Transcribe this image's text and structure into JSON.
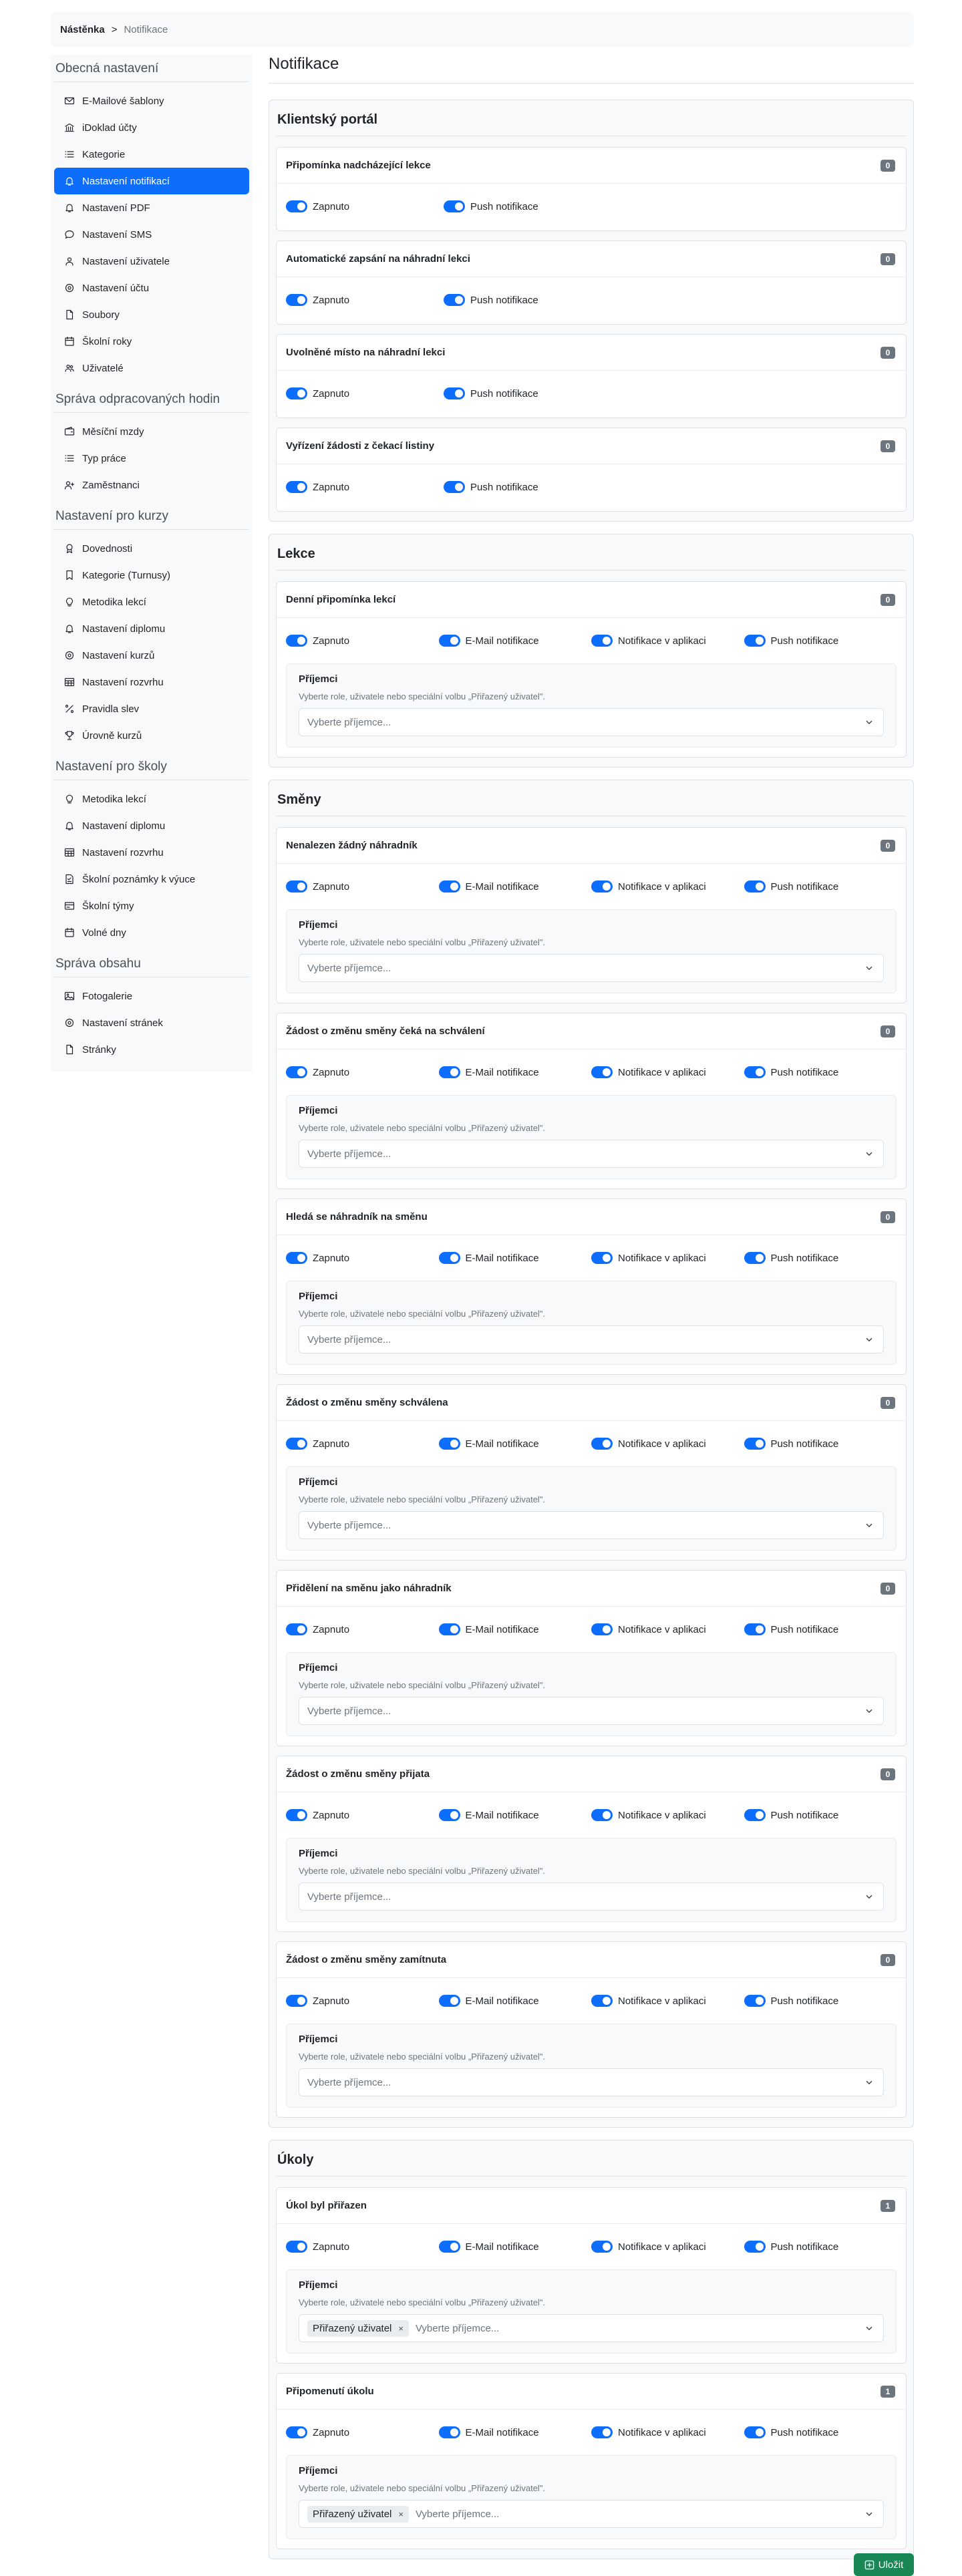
{
  "breadcrumb": {
    "home": "Nástěnka",
    "separator": ">",
    "current": "Notifikace"
  },
  "sidebar": {
    "sections": [
      {
        "title": "Obecná nastavení",
        "items": [
          {
            "label": "E-Mailové šablony",
            "icon": "mail-icon"
          },
          {
            "label": "iDoklad účty",
            "icon": "bank-icon"
          },
          {
            "label": "Kategorie",
            "icon": "list-icon"
          },
          {
            "label": "Nastavení notifikací",
            "icon": "bell-icon",
            "active": true
          },
          {
            "label": "Nastavení PDF",
            "icon": "bell-icon"
          },
          {
            "label": "Nastavení SMS",
            "icon": "chat-icon"
          },
          {
            "label": "Nastavení uživatele",
            "icon": "user-icon"
          },
          {
            "label": "Nastavení účtu",
            "icon": "gear-icon"
          },
          {
            "label": "Soubory",
            "icon": "file-icon"
          },
          {
            "label": "Školní roky",
            "icon": "calendar-icon"
          },
          {
            "label": "Uživatelé",
            "icon": "users-icon"
          }
        ]
      },
      {
        "title": "Správa odpracovaných hodin",
        "items": [
          {
            "label": "Měsíční mzdy",
            "icon": "wallet-icon"
          },
          {
            "label": "Typ práce",
            "icon": "list-icon"
          },
          {
            "label": "Zaměstnanci",
            "icon": "user-plus-icon"
          }
        ]
      },
      {
        "title": "Nastavení pro kurzy",
        "items": [
          {
            "label": "Dovednosti",
            "icon": "award-icon"
          },
          {
            "label": "Kategorie (Turnusy)",
            "icon": "bookmark-icon"
          },
          {
            "label": "Metodika lekcí",
            "icon": "bulb-icon"
          },
          {
            "label": "Nastavení diplomu",
            "icon": "bell-icon"
          },
          {
            "label": "Nastavení kurzů",
            "icon": "gear-icon"
          },
          {
            "label": "Nastavení rozvrhu",
            "icon": "table-icon"
          },
          {
            "label": "Pravidla slev",
            "icon": "percent-icon"
          },
          {
            "label": "Úrovně kurzů",
            "icon": "trophy-icon"
          }
        ]
      },
      {
        "title": "Nastavení pro školy",
        "items": [
          {
            "label": "Metodika lekcí",
            "icon": "bulb-icon"
          },
          {
            "label": "Nastavení diplomu",
            "icon": "bell-icon"
          },
          {
            "label": "Nastavení rozvrhu",
            "icon": "table-icon"
          },
          {
            "label": "Školní poznámky k výuce",
            "icon": "note-icon"
          },
          {
            "label": "Školní týmy",
            "icon": "card-icon"
          },
          {
            "label": "Volné dny",
            "icon": "calendar-icon"
          }
        ]
      },
      {
        "title": "Správa obsahu",
        "items": [
          {
            "label": "Fotogalerie",
            "icon": "image-icon"
          },
          {
            "label": "Nastavení stránek",
            "icon": "gear-icon"
          },
          {
            "label": "Stránky",
            "icon": "file-icon"
          }
        ]
      }
    ]
  },
  "main": {
    "title": "Notifikace",
    "labels": {
      "enabled": "Zapnuto",
      "email": "E-Mail notifikace",
      "app": "Notifikace v aplikaci",
      "push": "Push notifikace",
      "recipients_title": "Příjemci",
      "recipients_help": "Vyberte role, uživatele nebo speciální volbu „Přiřazený uživatel\".",
      "recipients_placeholder": "Vyberte příjemce...",
      "chip_remove": "×"
    },
    "sections": [
      {
        "title": "Klientský portál",
        "cards": [
          {
            "title": "Připomínka nadcházející lekce",
            "count": "0",
            "toggles": [
              "enabled",
              "push"
            ],
            "recipients": false,
            "chips": []
          },
          {
            "title": "Automatické zapsání na náhradní lekci",
            "count": "0",
            "toggles": [
              "enabled",
              "push"
            ],
            "recipients": false,
            "chips": []
          },
          {
            "title": "Uvolněné místo na náhradní lekci",
            "count": "0",
            "toggles": [
              "enabled",
              "push"
            ],
            "recipients": false,
            "chips": []
          },
          {
            "title": "Vyřízení žádosti z čekací listiny",
            "count": "0",
            "toggles": [
              "enabled",
              "push"
            ],
            "recipients": false,
            "chips": []
          }
        ]
      },
      {
        "title": "Lekce",
        "cards": [
          {
            "title": "Denní připomínka lekcí",
            "count": "0",
            "toggles": [
              "enabled",
              "email",
              "app",
              "push"
            ],
            "recipients": true,
            "chips": []
          }
        ]
      },
      {
        "title": "Směny",
        "cards": [
          {
            "title": "Nenalezen žádný náhradník",
            "count": "0",
            "toggles": [
              "enabled",
              "email",
              "app",
              "push"
            ],
            "recipients": true,
            "chips": []
          },
          {
            "title": "Žádost o změnu směny čeká na schválení",
            "count": "0",
            "toggles": [
              "enabled",
              "email",
              "app",
              "push"
            ],
            "recipients": true,
            "chips": []
          },
          {
            "title": "Hledá se náhradník na směnu",
            "count": "0",
            "toggles": [
              "enabled",
              "email",
              "app",
              "push"
            ],
            "recipients": true,
            "chips": []
          },
          {
            "title": "Žádost o změnu směny schválena",
            "count": "0",
            "toggles": [
              "enabled",
              "email",
              "app",
              "push"
            ],
            "recipients": true,
            "chips": []
          },
          {
            "title": "Přidělení na směnu jako náhradník",
            "count": "0",
            "toggles": [
              "enabled",
              "email",
              "app",
              "push"
            ],
            "recipients": true,
            "chips": []
          },
          {
            "title": "Žádost o změnu směny přijata",
            "count": "0",
            "toggles": [
              "enabled",
              "email",
              "app",
              "push"
            ],
            "recipients": true,
            "chips": []
          },
          {
            "title": "Žádost o změnu směny zamítnuta",
            "count": "0",
            "toggles": [
              "enabled",
              "email",
              "app",
              "push"
            ],
            "recipients": true,
            "chips": []
          }
        ]
      },
      {
        "title": "Úkoly",
        "cards": [
          {
            "title": "Úkol byl přiřazen",
            "count": "1",
            "toggles": [
              "enabled",
              "email",
              "app",
              "push"
            ],
            "recipients": true,
            "chips": [
              "Přiřazený uživatel"
            ]
          },
          {
            "title": "Připomenutí úkolu",
            "count": "1",
            "toggles": [
              "enabled",
              "email",
              "app",
              "push"
            ],
            "recipients": true,
            "chips": [
              "Přiřazený uživatel"
            ]
          }
        ]
      }
    ]
  },
  "save_label": "Uložit",
  "colors": {
    "accent": "#0d6efd",
    "save": "#198754",
    "badge": "#6c757d"
  }
}
